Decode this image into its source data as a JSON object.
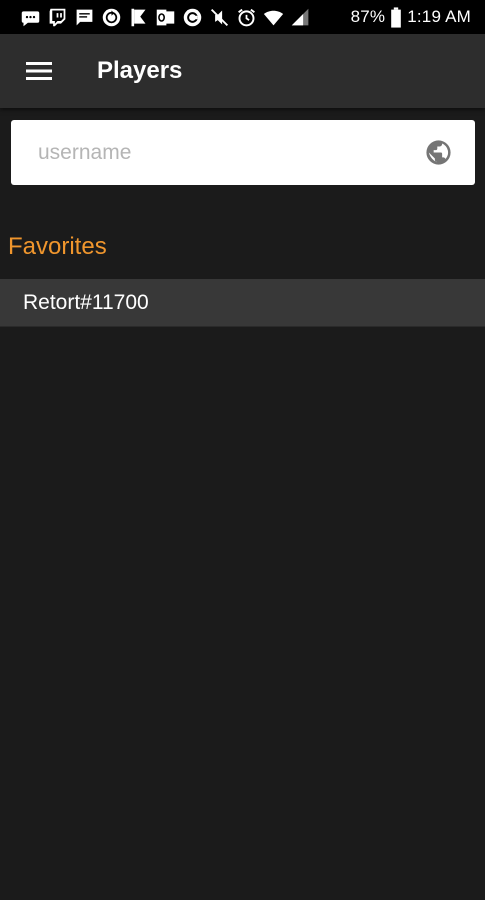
{
  "status_bar": {
    "icons": [
      "message-icon",
      "twitch-icon",
      "chat-icon",
      "sync-icon",
      "flag-icon",
      "outlook-icon",
      "app-icon",
      "mute-icon",
      "alarm-icon",
      "wifi-icon",
      "signal-icon"
    ],
    "battery": "87%",
    "time": "1:19 AM"
  },
  "app_bar": {
    "title": "Players"
  },
  "search": {
    "placeholder": "username",
    "value": ""
  },
  "favorites": {
    "title": "Favorites",
    "items": [
      {
        "label": "Retort#11700"
      }
    ]
  },
  "colors": {
    "accent": "#f0962d",
    "background": "#1b1b1b",
    "app_bar": "#2d2d2d",
    "list_item": "#383838"
  }
}
